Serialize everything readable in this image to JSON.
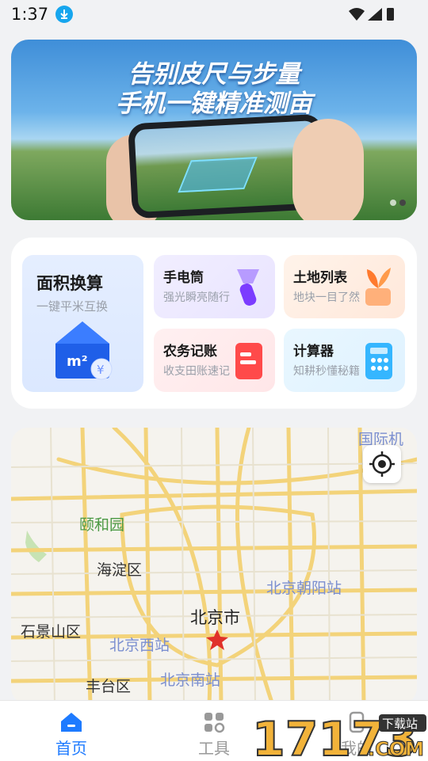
{
  "status": {
    "time": "1:37"
  },
  "banner": {
    "title_line1": "告别皮尺与步量",
    "title_line2": "手机一键精准测亩",
    "dots": 2,
    "active_dot": 1
  },
  "tools": {
    "big": {
      "title": "面积换算",
      "subtitle": "一键平米互换",
      "icon": "m²"
    },
    "cards": [
      {
        "title": "手电筒",
        "subtitle": "强光瞬亮随行",
        "icon": "flashlight-icon"
      },
      {
        "title": "土地列表",
        "subtitle": "地块一目了然",
        "icon": "plant-list-icon"
      },
      {
        "title": "农务记账",
        "subtitle": "收支田账速记",
        "icon": "ledger-icon"
      },
      {
        "title": "计算器",
        "subtitle": "知耕秒懂秘籍",
        "icon": "calculator-icon"
      }
    ]
  },
  "map": {
    "labels": {
      "airport": "国际机",
      "yiheyuan": "颐和园",
      "haidian": "海淀区",
      "chaoyang_station": "北京朝阳站",
      "beijing": "北京市",
      "shijingshan": "石景山区",
      "west_station": "北京西站",
      "south_station": "北京南站",
      "fengtai": "丰台区"
    }
  },
  "tabbar": {
    "home": "首页",
    "tools": "工具",
    "mine": "我的"
  },
  "watermark": {
    "number": "17173",
    "tag": "下载站",
    "domain": ".COM"
  },
  "colors": {
    "accent": "#1e7bff",
    "tab_inactive": "#999999"
  }
}
